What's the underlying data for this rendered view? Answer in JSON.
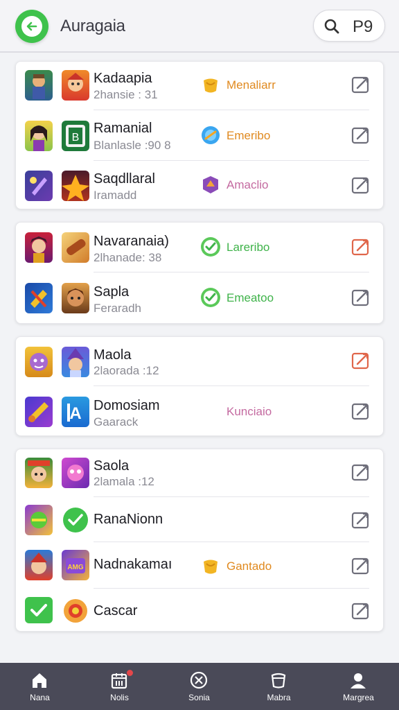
{
  "header": {
    "title": "Auragaia",
    "search_count": "P9",
    "accent": "#3fc24c"
  },
  "groups": [
    {
      "rows": [
        {
          "title": "Kadaapia",
          "subtitle": "2hansie : 31",
          "tag": {
            "label": "Menaliarr",
            "icon": "honey-pot-icon",
            "color": "#e08a20"
          }
        },
        {
          "title": "Ramanial",
          "subtitle": "Blanlasle :90 8",
          "tag": {
            "label": "Emeribo",
            "icon": "blue-orb-icon",
            "color": "#e08a20"
          }
        },
        {
          "title": "Saqdllaral",
          "subtitle": "Iramadd",
          "tag": {
            "label": "Amaclio",
            "icon": "purple-gem-icon",
            "color": "#c46aa0"
          }
        }
      ]
    },
    {
      "rows": [
        {
          "title": "Navaranaia)",
          "subtitle": "2lhanade: 38",
          "tag": {
            "label": "Lareribo",
            "icon": "green-check-icon",
            "color": "#3fb34a"
          }
        },
        {
          "title": "Sapla",
          "subtitle": "Feraradh",
          "tag": {
            "label": "Emeatoo",
            "icon": "green-check-icon",
            "color": "#3fb34a"
          }
        }
      ]
    },
    {
      "rows": [
        {
          "title": "Maola",
          "subtitle": "2laorada :12",
          "tag": null
        },
        {
          "title": "Domosiam",
          "subtitle": "Gaarack",
          "tag": {
            "label": "Kunciaio",
            "icon": "",
            "color": "#c46aa0"
          }
        }
      ]
    },
    {
      "rows": [
        {
          "title": "Saola",
          "subtitle": "2lamala :12",
          "tag": null
        },
        {
          "title": "RanaNionn",
          "subtitle": "",
          "tag": null
        },
        {
          "title": "Nadnakamaı",
          "subtitle": "",
          "tag": {
            "label": "Gantado",
            "icon": "honey-pot-icon",
            "color": "#e08a20"
          }
        },
        {
          "title": "Cascar",
          "subtitle": "",
          "tag": null
        }
      ]
    }
  ],
  "nav": [
    {
      "label": "Nana",
      "icon": "home-icon"
    },
    {
      "label": "Nolis",
      "icon": "calendar-icon"
    },
    {
      "label": "Sonia",
      "icon": "compass-icon"
    },
    {
      "label": "Mabra",
      "icon": "cup-icon"
    },
    {
      "label": "Margrea",
      "icon": "profile-icon"
    }
  ]
}
